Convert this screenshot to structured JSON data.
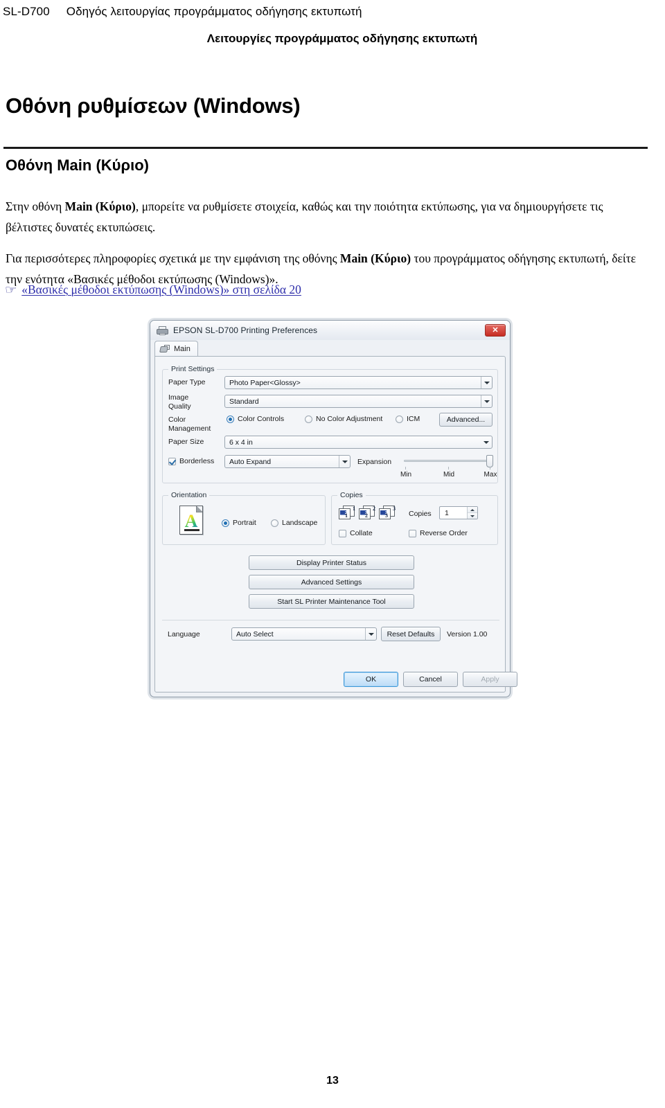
{
  "doc": {
    "model": "SL-D700",
    "header_title": "Οδηγός λειτουργίας προγράμματος οδήγησης εκτυπωτή",
    "subtitle": "Λειτουργίες προγράμματος οδήγησης εκτυπωτή",
    "h1": "Οθόνη ρυθμίσεων (Windows)",
    "h2": "Οθόνη Main (Κύριο)",
    "para1_a": "Στην οθόνη ",
    "para1_b": "Main (Κύριο)",
    "para1_c": ", μπορείτε να ρυθμίσετε στοιχεία, καθώς και την ποιότητα εκτύπωσης, για να δημιουργήσετε τις βέλτιστες δυνατές εκτυπώσεις.",
    "para2_a": "Για περισσότερες πληροφορίες σχετικά με την εμφάνιση της οθόνης ",
    "para2_b": "Main (Κύριο)",
    "para2_c": " του προγράμματος οδήγησης εκτυπωτή, δείτε την ενότητα «Βασικές μέθοδοι εκτύπωσης (Windows)».",
    "xref_icon": "☞",
    "xref_link": "«Βασικές μέθοδοι εκτύπωσης (Windows)» στη σελίδα 20",
    "page_number": "13",
    "link_color": "#2e2eaa"
  },
  "dialog": {
    "title": "EPSON SL-D700 Printing Preferences",
    "close_label": "✕",
    "tab": {
      "label": "Main"
    },
    "print_settings": {
      "group_label": "Print Settings",
      "paper_type_label": "Paper Type",
      "paper_type_value": "Photo Paper<Glossy>",
      "image_quality_label_1": "Image",
      "image_quality_label_2": "Quality",
      "image_quality_value": "Standard",
      "color_management_label_1": "Color",
      "color_management_label_2": "Management",
      "radio_color_controls": "Color Controls",
      "radio_no_color_adjustment": "No Color Adjustment",
      "radio_icm": "ICM",
      "advanced_button": "Advanced...",
      "paper_size_label": "Paper Size",
      "paper_size_value": "6 x 4 in",
      "borderless_label": "Borderless",
      "borderless_method_value": "Auto Expand",
      "expansion_label": "Expansion",
      "expansion_ticks": [
        "Min",
        "Mid",
        "Max"
      ]
    },
    "orientation": {
      "group_label": "Orientation",
      "portrait": "Portrait",
      "landscape": "Landscape",
      "icon_glyph": "A"
    },
    "copies": {
      "group_label": "Copies",
      "copies_label": "Copies",
      "copies_value": "1",
      "collate_label": "Collate",
      "reverse_order_label": "Reverse Order",
      "stack_numbers": [
        "1",
        "2",
        "3"
      ]
    },
    "action_buttons": {
      "display_printer_status": "Display Printer Status",
      "advanced_settings": "Advanced Settings",
      "start_maintenance_tool": "Start SL Printer Maintenance Tool"
    },
    "footer": {
      "language_label": "Language",
      "language_value": "Auto Select",
      "reset_defaults": "Reset Defaults",
      "version": "Version 1.00",
      "ok": "OK",
      "cancel": "Cancel",
      "apply": "Apply"
    }
  }
}
